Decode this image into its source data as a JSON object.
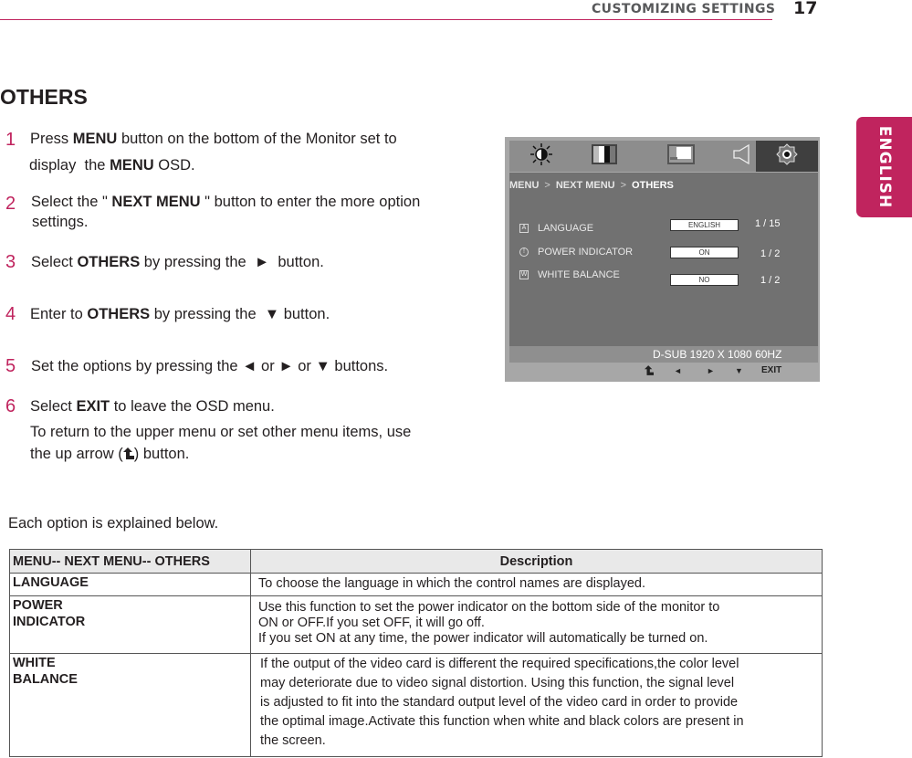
{
  "header": {
    "section": "CUSTOMIZING SETTINGS",
    "page_number": "17",
    "side_tab": "ENGLISH",
    "accent_color": "#c0245e"
  },
  "title": "OTHERS",
  "steps": [
    {
      "num": "1",
      "parts": [
        "Press ",
        "MENU",
        " button on the bottom of the Monitor set to"
      ],
      "line2_parts": [
        "display  the ",
        "MENU",
        " OSD."
      ]
    },
    {
      "num": "2",
      "parts": [
        "Select the \" ",
        "NEXT MENU",
        " \" button to enter the more option"
      ],
      "line2": "settings."
    },
    {
      "num": "3",
      "parts": [
        "Select ",
        "OTHERS",
        " by pressing the  ►  button."
      ]
    },
    {
      "num": "4",
      "parts": [
        "Enter to ",
        "OTHERS",
        " by pressing the  ▼ button."
      ]
    },
    {
      "num": "5",
      "text": "Set the options by pressing the ◄ or ► or ▼ buttons."
    },
    {
      "num": "6",
      "parts": [
        "Select ",
        "EXIT",
        " to leave the OSD menu."
      ],
      "line2": "To return to the upper menu or set other menu items, use",
      "line3_pre": "the up arrow (",
      "line3_icon": "up-arrow-return",
      "line3_post": ") button."
    }
  ],
  "osd": {
    "tabs": [
      {
        "icon": "brightness-icon"
      },
      {
        "icon": "color-bars-icon"
      },
      {
        "icon": "picture-icon"
      },
      {
        "icon": "speaker-icon"
      },
      {
        "icon": "gear-icon",
        "active": true
      }
    ],
    "breadcrumb": [
      "MENU",
      "NEXT MENU",
      "OTHERS"
    ],
    "items": [
      {
        "icon": "A",
        "label": "LANGUAGE",
        "value": "ENGLISH",
        "position": "1 / 15"
      },
      {
        "icon": "!",
        "label": "POWER INDICATOR",
        "value": "ON",
        "position": "1 / 2"
      },
      {
        "icon": "W",
        "label": "WHITE BALANCE",
        "value": "NO",
        "position": "1 / 2"
      }
    ],
    "status": "D-SUB 1920 X 1080 60HZ",
    "nav": {
      "back": "⬑",
      "left": "◄",
      "right": "►",
      "down": "▼",
      "exit": "EXIT"
    }
  },
  "intro": "Each option is explained below.",
  "table": {
    "headers": [
      "MENU-- NEXT MENU-- OTHERS",
      "Description"
    ],
    "rows": [
      {
        "key": "LANGUAGE",
        "desc": [
          "To choose the language in which the control names are displayed."
        ]
      },
      {
        "key_lines": [
          "POWER",
          "INDICATOR"
        ],
        "desc": [
          "Use this function to set the power indicator on the bottom side of the monitor to",
          "ON or OFF.If you set OFF, it will go off.",
          "If you set ON at any time, the power indicator will automatically be turned on."
        ]
      },
      {
        "key_lines": [
          "WHITE",
          "BALANCE"
        ],
        "desc": [
          "If the output of the video card is different the required specifications,the color level",
          "may deteriorate due to video signal distortion. Using this function, the signal level",
          "is adjusted to fit into the standard output level of the video card in order to provide",
          "the optimal image.Activate this function when white and black colors are present in",
          "the screen."
        ]
      }
    ]
  }
}
